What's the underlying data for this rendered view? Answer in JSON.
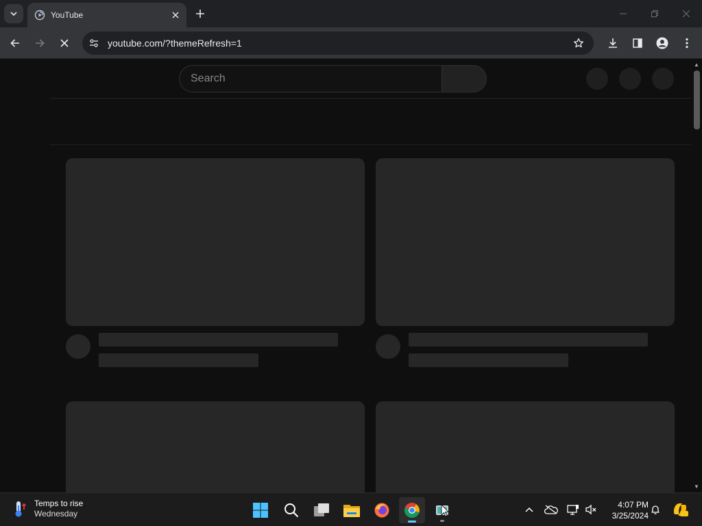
{
  "browser": {
    "tab_title": "YouTube",
    "url": "youtube.com/?themeRefresh=1"
  },
  "page": {
    "search_placeholder": "Search"
  },
  "taskbar": {
    "weather_title": "Temps to rise",
    "weather_subtitle": "Wednesday",
    "time": "4:07 PM",
    "date": "3/25/2024"
  },
  "icons": [
    "tab-search-icon",
    "youtube-favicon",
    "close-icon",
    "plus-icon",
    "minimize-icon",
    "restore-icon",
    "window-close-icon",
    "back-icon",
    "forward-icon",
    "stop-loading-icon",
    "site-info-icon",
    "star-icon",
    "download-icon",
    "side-panel-icon",
    "profile-icon",
    "menu-icon",
    "thermometer-icon",
    "windows-start-icon",
    "search-icon",
    "task-view-icon",
    "file-explorer-icon",
    "firefox-icon",
    "chrome-icon",
    "cursor-app-icon",
    "chevron-up-icon",
    "onedrive-icon",
    "network-icon",
    "volume-muted-icon",
    "bell-icon",
    "copilot-icon"
  ],
  "colors": {
    "page_bg": "#0f0f0f",
    "placeholder": "#272727",
    "chrome_dark": "#202124",
    "chrome_toolbar": "#35363a",
    "taskbar": "#1c1c1c",
    "accent": "#60cdff"
  }
}
